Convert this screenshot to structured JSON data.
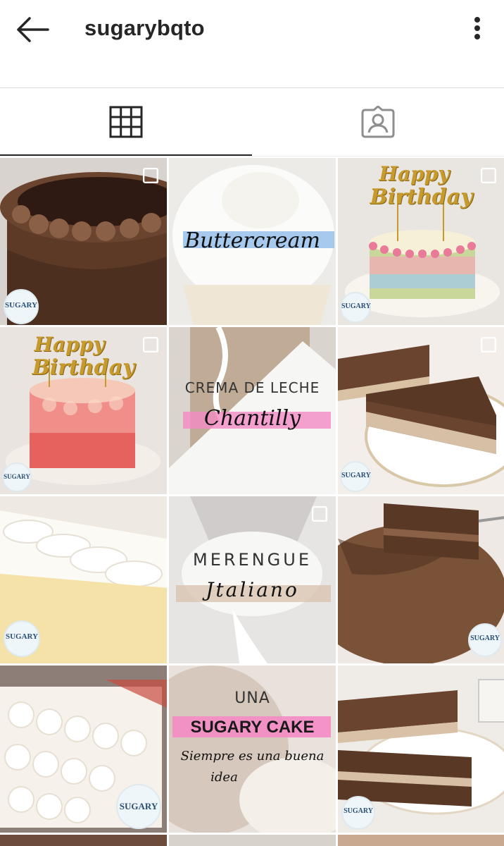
{
  "header": {
    "username": "sugarybqto",
    "back_icon": "arrow-left-icon",
    "more_icon": "more-vertical-icon"
  },
  "tabs": [
    {
      "name": "grid",
      "icon": "grid-icon",
      "selected": true
    },
    {
      "name": "tagged",
      "icon": "tagged-person-icon",
      "selected": false
    }
  ],
  "posts": {
    "p2": {
      "line1": "Buttercream"
    },
    "p3": {
      "line1": "Happy",
      "line2": "Birthday"
    },
    "p4": {
      "line1": "Happy",
      "line2": "Birthday"
    },
    "p5": {
      "line1": "CREMA DE LECHE",
      "line2": "Chantilly"
    },
    "p8": {
      "line1": "MERENGUE",
      "line2": "Jtaliano"
    },
    "p11": {
      "line1": "UNA",
      "line2": "SUGARY CAKE",
      "line3": "Siempre es una buena",
      "line4": "idea"
    }
  },
  "logo_text": "SUGARY",
  "colors": {
    "chocolate": "#5a3826",
    "cream": "#f4efe9",
    "pink_accent": "#f48bc4",
    "blue_accent": "#8ab8e8",
    "gold": "#c69a2c"
  }
}
